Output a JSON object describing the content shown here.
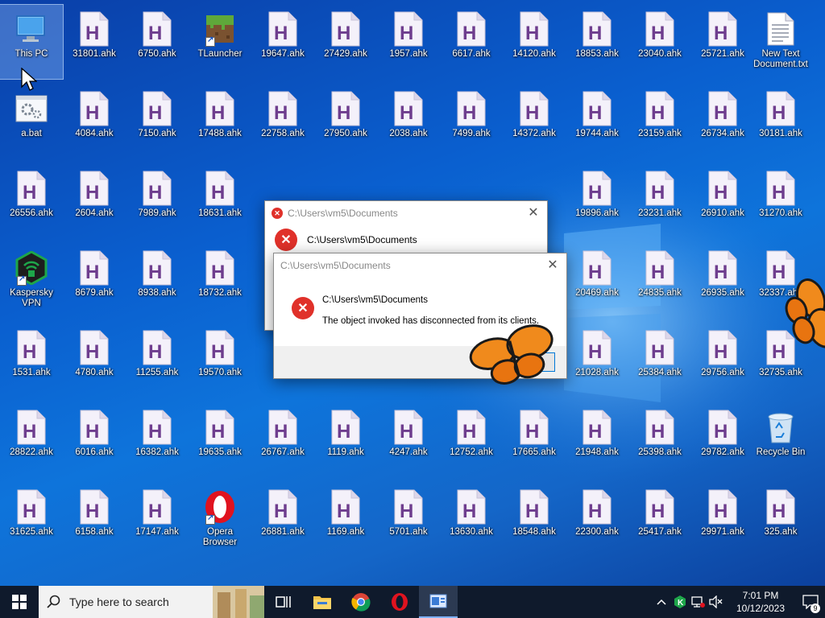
{
  "desktop": {
    "icons": [
      [
        "This PC",
        "31801.ahk",
        "6750.ahk",
        "TLauncher",
        "19647.ahk",
        "27429.ahk",
        "1957.ahk",
        "6617.ahk",
        "14120.ahk",
        "18853.ahk",
        "23040.ahk",
        "25721.ahk",
        "New Text Document.txt"
      ],
      [
        "a.bat",
        "4084.ahk",
        "7150.ahk",
        "17488.ahk",
        "22758.ahk",
        "27950.ahk",
        "2038.ahk",
        "7499.ahk",
        "14372.ahk",
        "19744.ahk",
        "23159.ahk",
        "26734.ahk",
        "30181.ahk"
      ],
      [
        "26556.ahk",
        "2604.ahk",
        "7989.ahk",
        "18631.ahk",
        "",
        "",
        "",
        "",
        "",
        "19896.ahk",
        "23231.ahk",
        "26910.ahk",
        "31270.ahk"
      ],
      [
        "Kaspersky VPN",
        "8679.ahk",
        "8938.ahk",
        "18732.ahk",
        "",
        "",
        "",
        "",
        "",
        "20469.ahk",
        "24835.ahk",
        "26935.ahk",
        "32337.ahk"
      ],
      [
        "1531.ahk",
        "4780.ahk",
        "11255.ahk",
        "19570.ahk",
        "",
        "",
        "",
        "",
        "",
        "21028.ahk",
        "25384.ahk",
        "29756.ahk",
        "32735.ahk"
      ],
      [
        "28822.ahk",
        "6016.ahk",
        "16382.ahk",
        "19635.ahk",
        "26767.ahk",
        "1119.ahk",
        "4247.ahk",
        "12752.ahk",
        "17665.ahk",
        "21948.ahk",
        "25398.ahk",
        "29782.ahk",
        "Recycle Bin"
      ],
      [
        "31625.ahk",
        "6158.ahk",
        "17147.ahk",
        "Opera Browser",
        "26881.ahk",
        "1169.ahk",
        "5701.ahk",
        "13630.ahk",
        "18548.ahk",
        "22300.ahk",
        "25417.ahk",
        "29971.ahk",
        "325.ahk"
      ]
    ]
  },
  "dialog_back": {
    "title": "C:\\Users\\vm5\\Documents",
    "path": "C:\\Users\\vm5\\Documents",
    "close": "✕"
  },
  "dialog_front": {
    "title": "C:\\Users\\vm5\\Documents",
    "path": "C:\\Users\\vm5\\Documents",
    "message": "The object invoked has disconnected from its clients.",
    "close": "✕"
  },
  "taskbar": {
    "search_placeholder": "Type here to search",
    "time": "7:01 PM",
    "date": "10/12/2023",
    "notification_count": "9"
  },
  "colors": {
    "taskbar": "#0f1a2c",
    "ahk_letter": "#6e3d8e",
    "error_red": "#e0312a"
  }
}
